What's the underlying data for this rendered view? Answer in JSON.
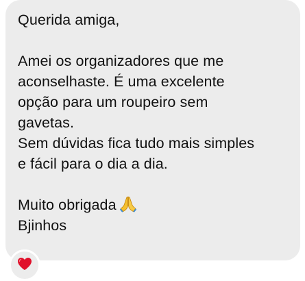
{
  "message": {
    "lines": [
      "Querida amiga,",
      "",
      "Amei os organizadores que me",
      "aconselhaste. É uma excelente",
      "opção para um roupeiro sem",
      "gavetas.",
      "Sem dúvidas fica tudo mais simples",
      "e fácil para o dia a dia.",
      "",
      "Muito obrigada",
      "Bjinhos"
    ],
    "inline_emoji": "folded-hands",
    "bubble_color": "#ececec",
    "text_color": "#111111"
  },
  "reaction": {
    "emoji": "red-heart",
    "color": "#e0102a"
  }
}
